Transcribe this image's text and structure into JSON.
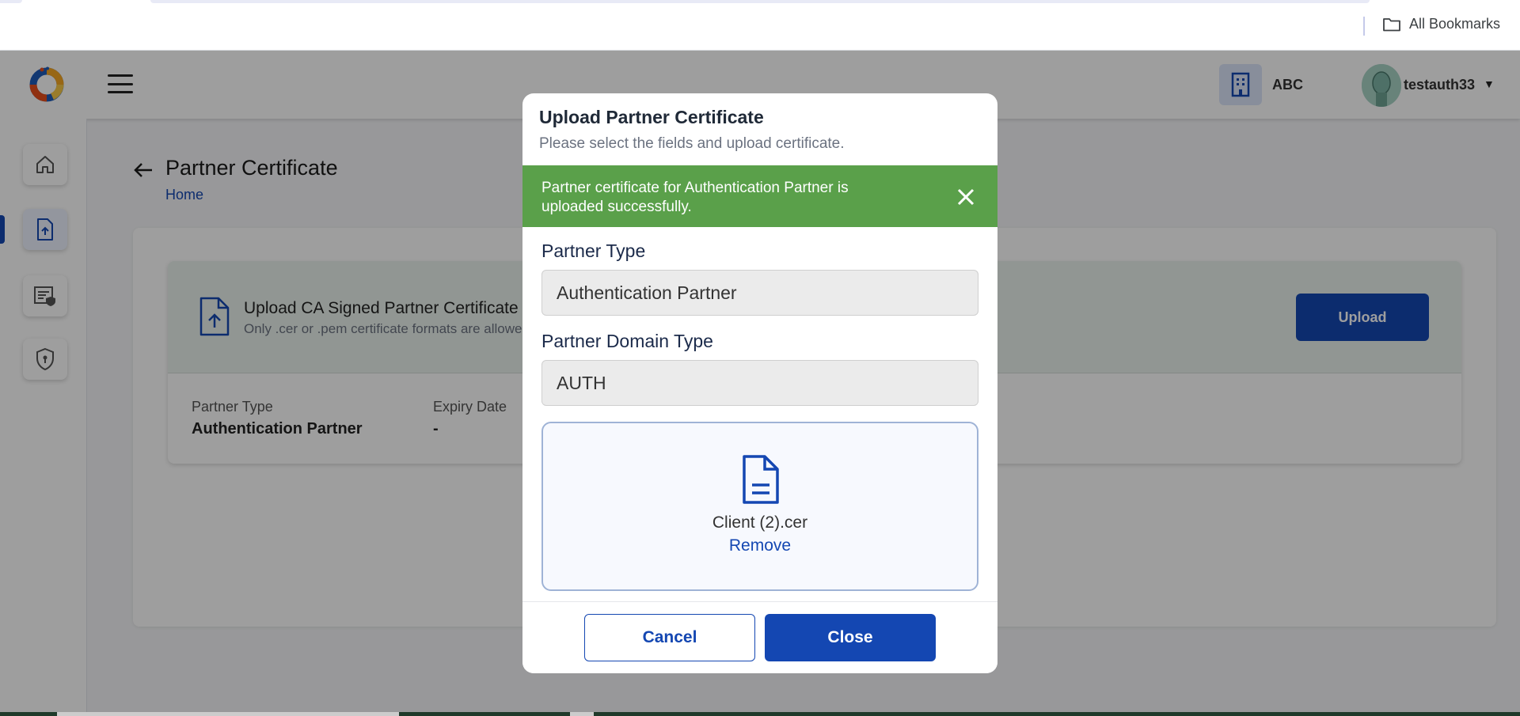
{
  "browser": {
    "bookmarks_label": "All Bookmarks"
  },
  "header": {
    "org_name": "ABC",
    "username": "testauth33"
  },
  "sidebar": {
    "items": [
      {
        "name": "home",
        "icon": "home-icon",
        "active": false
      },
      {
        "name": "upload-certificate",
        "icon": "file-upload-icon",
        "active": true
      },
      {
        "name": "policies",
        "icon": "document-shield-icon",
        "active": false
      },
      {
        "name": "security",
        "icon": "shield-icon",
        "active": false
      }
    ]
  },
  "page": {
    "title": "Partner Certificate",
    "breadcrumb": "Home"
  },
  "certificate_card": {
    "title": "Upload CA Signed Partner Certificate",
    "subtitle": "Only .cer or .pem certificate formats are allowed",
    "upload_label": "Upload",
    "partner_type_label": "Partner Type",
    "partner_type_value": "Authentication Partner",
    "expiry_label": "Expiry Date",
    "expiry_value": "-"
  },
  "modal": {
    "title": "Upload Partner Certificate",
    "subtitle": "Please select the fields and upload certificate.",
    "success_message": "Partner certificate for Authentication Partner is uploaded successfully.",
    "partner_type_label": "Partner Type",
    "partner_type_value": "Authentication Partner",
    "domain_type_label": "Partner Domain Type",
    "domain_type_value": "AUTH",
    "file_name": "Client (2).cer",
    "remove_label": "Remove",
    "cancel_label": "Cancel",
    "close_label": "Close"
  },
  "colors": {
    "primary": "#1447b2",
    "success": "#5aa04a",
    "card_header_bg": "#eaf3ee"
  }
}
